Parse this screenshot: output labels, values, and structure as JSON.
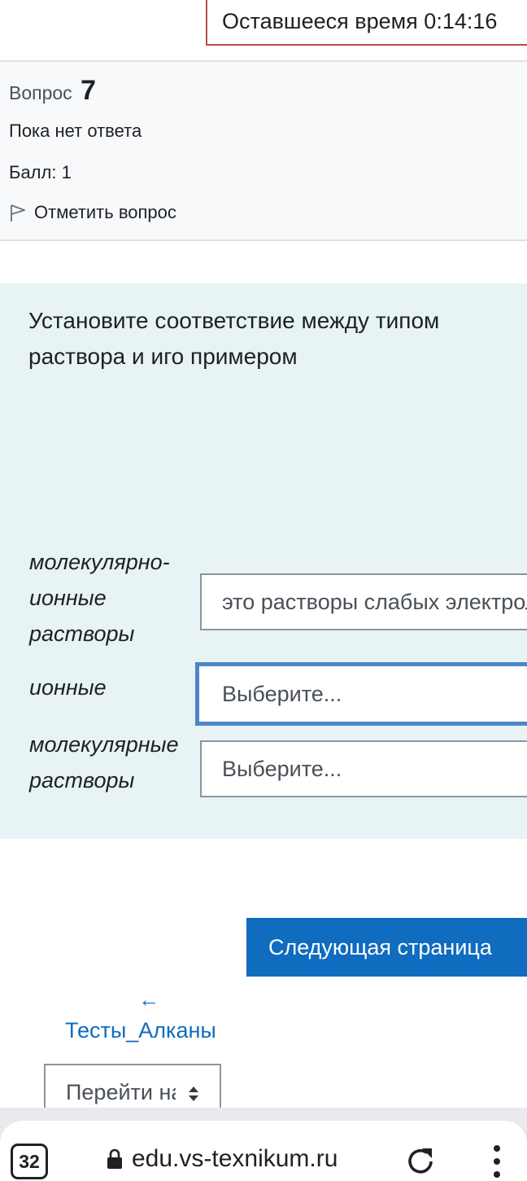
{
  "timer": {
    "label": "Оставшееся время 0:14:16"
  },
  "question_info": {
    "label": "Вопрос",
    "number": "7",
    "state": "Пока нет ответа",
    "grade": "Балл: 1",
    "flag": "Отметить вопрос"
  },
  "question": {
    "text": "Установите соответствие между типом раствора и иго примером",
    "rows": [
      {
        "stem": " молекулярно-ионные растворы",
        "selected": "это растворы слабых электролитов"
      },
      {
        "stem": "ионные",
        "selected": "Выберите..."
      },
      {
        "stem": "молекулярные растворы",
        "selected": "Выберите..."
      }
    ]
  },
  "navigation": {
    "next_button": "Следующая страница",
    "back_arrow": "←",
    "back_link": "Тесты_Алканы",
    "jump_select": "Перейти на..."
  },
  "browser": {
    "tab_count": "32",
    "url": "edu.vs-texnikum.ru"
  }
}
